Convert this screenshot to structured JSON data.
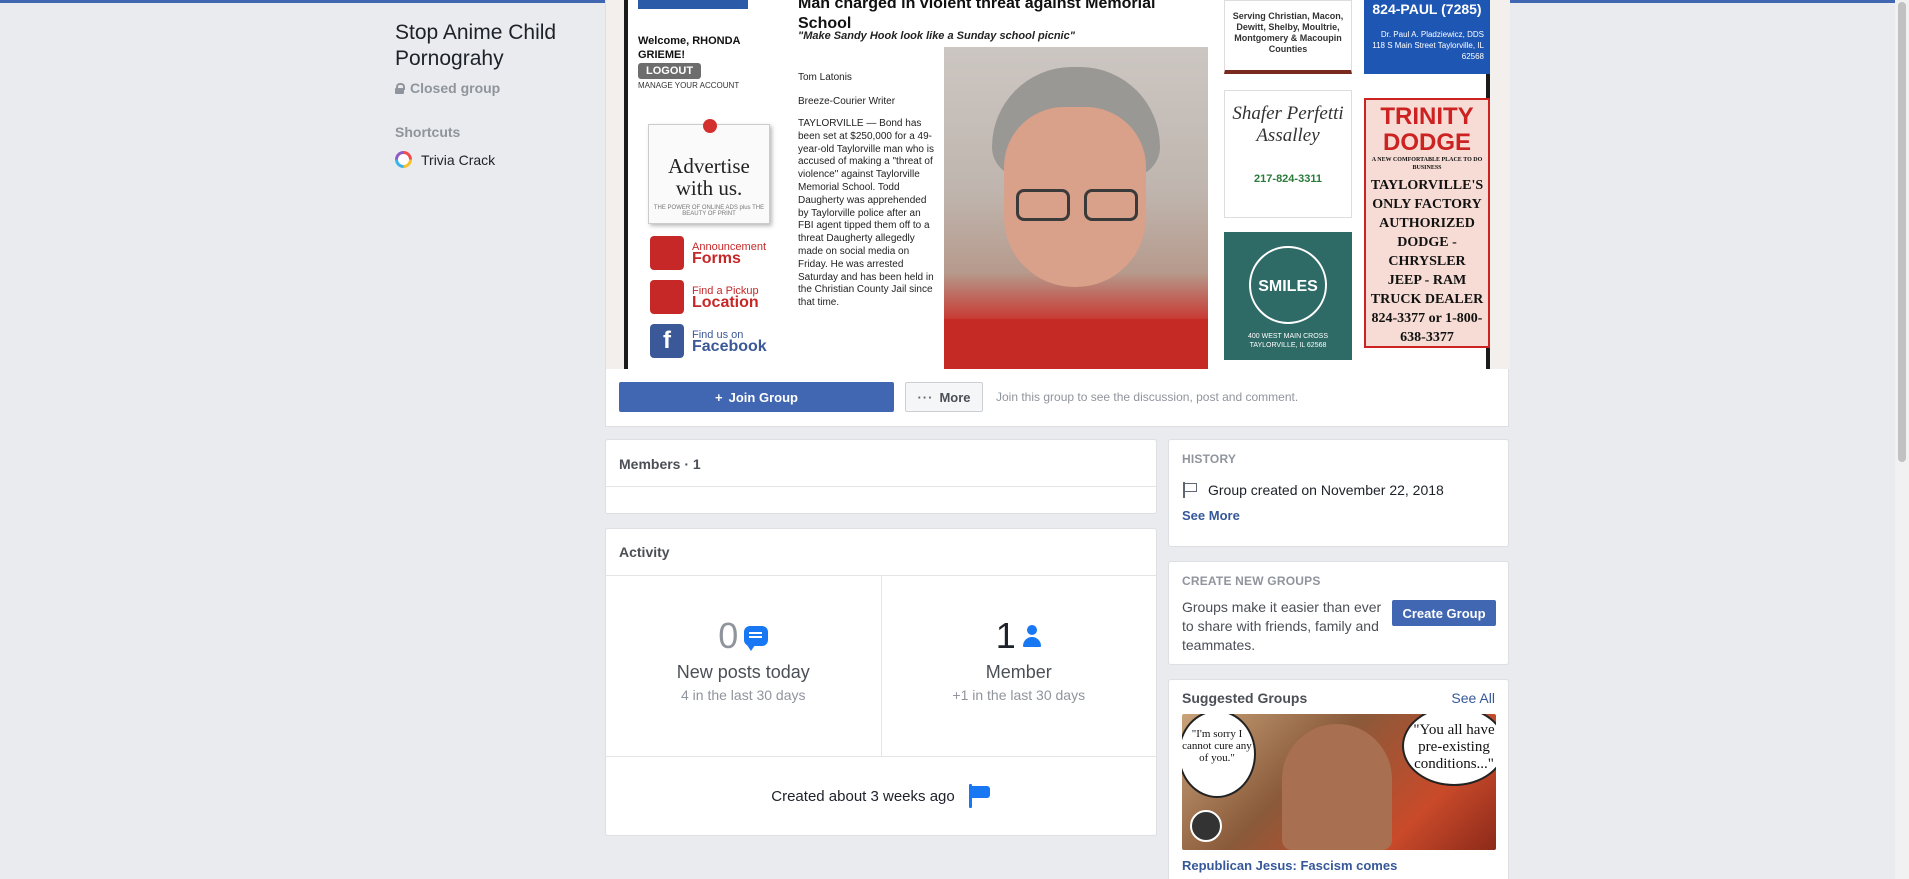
{
  "group": {
    "title": "Stop Anime Child Pornograhy",
    "privacy": "Closed group"
  },
  "sidebar": {
    "shortcuts_heading": "Shortcuts",
    "shortcuts": [
      {
        "label": "Trivia Crack",
        "icon": "trivia-crack-icon"
      }
    ]
  },
  "cover": {
    "newspaper": {
      "welcome": "Welcome, RHONDA GRIEME!",
      "logout": "LOGOUT",
      "manage": "MANAGE YOUR ACCOUNT",
      "advertise": "Advertise with us.",
      "advertise_small": "THE POWER OF ONLINE ADS plus THE BEAUTY OF PRINT",
      "links": [
        {
          "small": "Announcement",
          "big": "Forms"
        },
        {
          "small": "Find a Pickup",
          "big": "Location"
        },
        {
          "small": "Find us on",
          "big": "Facebook"
        }
      ],
      "headline": "Man charged in violent threat against Memorial School",
      "subhead": "\"Make Sandy Hook look like a Sunday school picnic\"",
      "author": "Tom Latonis",
      "author_role": "Breeze-Courier Writer",
      "body": "TAYLORVILLE — Bond has been set at $250,000 for a 49-year-old Taylorville man who is accused of making a \"threat of violence\" against Taylorville Memorial School. Todd Daugherty was apprehended by Taylorville police after an FBI agent tipped them off to a threat Daugherty allegedly made on social media on Friday. He was arrested Saturday and has been held in the Christian County Jail since that time.",
      "ad_counties": "Serving Christian, Macon, Dewitt, Shelby, Moultrie, Montgomery & Macoupin Counties",
      "ad_paul_phone": "824-PAUL (7285)",
      "ad_paul_lines": "Dr. Paul A. Pladziewicz, DDS 118 S Main Street Taylorville, IL 62568",
      "ad_shafer": "Shafer Perfetti Assalley",
      "ad_shafer_phone": "217-824-3311",
      "ad_smiles": "SMILES",
      "ad_smiles_addr": "400 WEST MAIN CROSS TAYLORVILLE, IL 62568",
      "ad_trinity_name": "TRINITY DODGE",
      "ad_trinity_tag": "A NEW COMFORTABLE PLACE TO DO BUSINESS",
      "ad_trinity_body": "TAYLORVILLE'S ONLY FACTORY AUTHORIZED DODGE - CHRYSLER JEEP - RAM TRUCK DEALER 824-3377 or 1-800-638-3377"
    }
  },
  "actions": {
    "join_label": "Join Group",
    "more_label": "More",
    "hint": "Join this group to see the discussion, post and comment."
  },
  "members": {
    "heading": "Members · 1"
  },
  "activity": {
    "heading": "Activity",
    "posts_count": "0",
    "posts_label": "New posts today",
    "posts_sub": "4 in the last 30 days",
    "members_count": "1",
    "members_label": "Member",
    "members_sub": "+1 in the last 30 days",
    "created": "Created about 3 weeks ago"
  },
  "history": {
    "heading": "HISTORY",
    "created": "Group created on November 22, 2018",
    "see_more": "See More"
  },
  "create_groups": {
    "heading": "CREATE NEW GROUPS",
    "text": "Groups make it easier than ever to share with friends, family and teammates.",
    "button": "Create Group"
  },
  "suggested": {
    "heading": "Suggested Groups",
    "see_all": "See All",
    "bubble_left": "\"I'm sorry I cannot cure any of you.\"",
    "bubble_right": "\"You all have pre-existing conditions...\"",
    "group_name": "Republican Jesus: Fascism comes"
  },
  "colors": {
    "brand": "#4267b2",
    "link": "#365899",
    "background": "#e9ebee"
  }
}
